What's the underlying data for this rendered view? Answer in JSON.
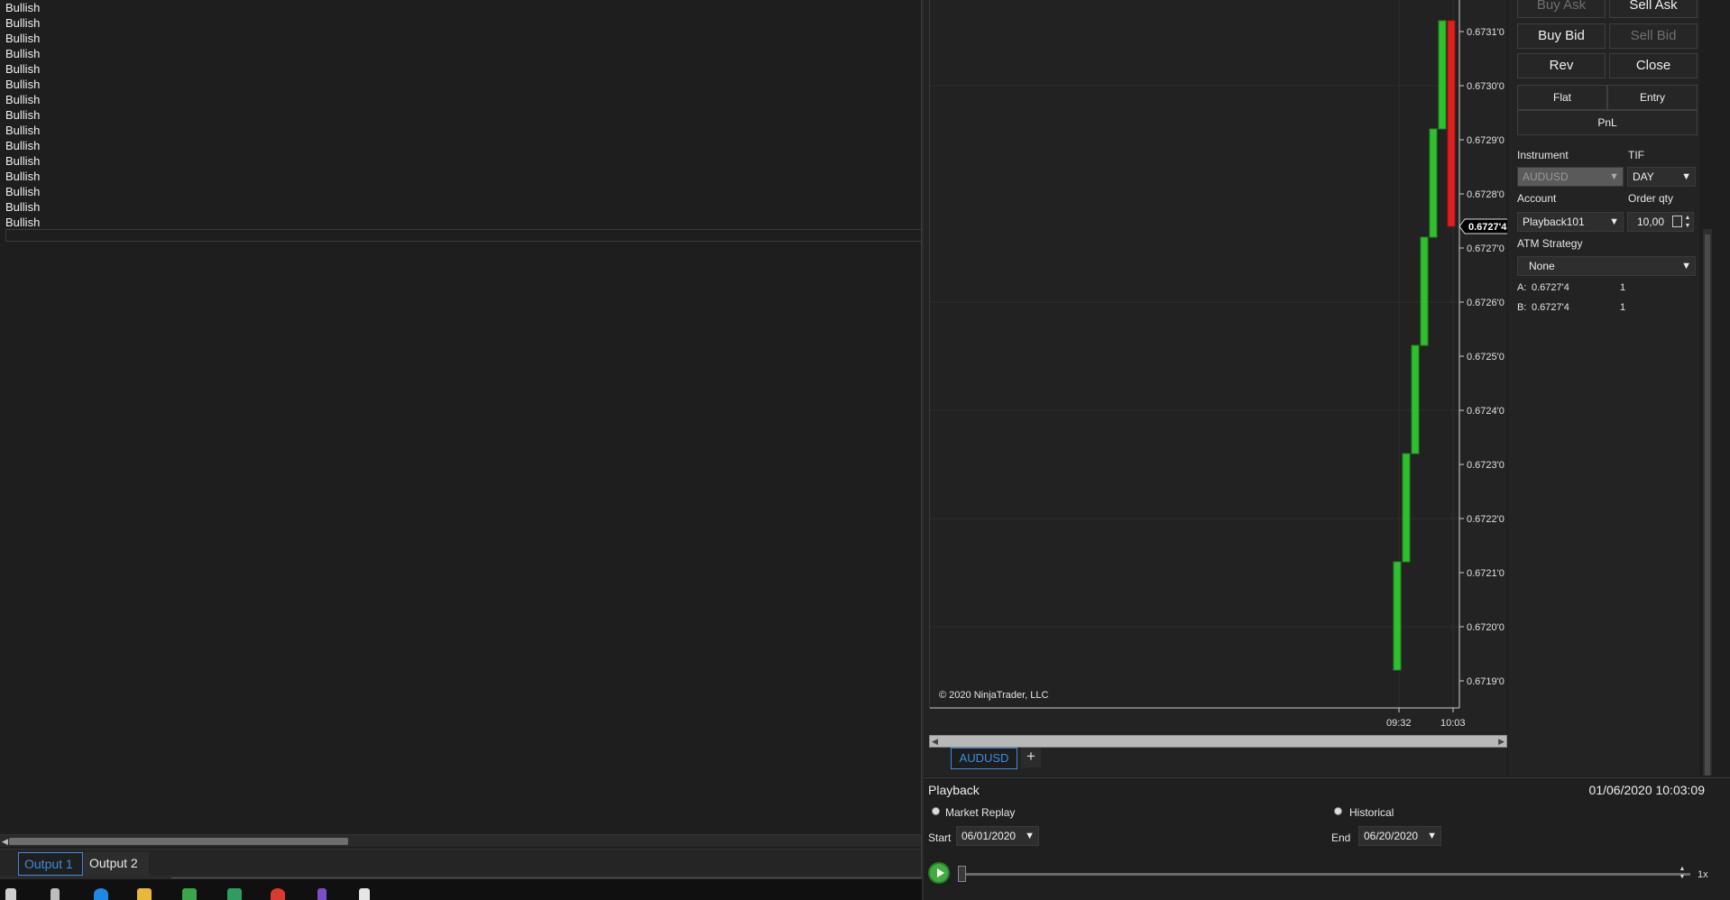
{
  "output": {
    "lines": [
      "Bullish",
      "Bullish",
      "Bullish",
      "Bullish",
      "Bullish",
      "Bullish",
      "Bullish",
      "Bullish",
      "Bullish",
      "Bullish",
      "Bullish",
      "Bullish",
      "Bullish",
      "Bullish",
      "Bullish"
    ],
    "tabs": [
      {
        "label": "Output 1",
        "active": true
      },
      {
        "label": "Output 2",
        "active": false
      }
    ]
  },
  "chart": {
    "instrument_tab": "AUDUSD",
    "add_tab": "+",
    "copyright": "© 2020 NinjaTrader, LLC",
    "current_price_label": "0.6727'4",
    "price_axis_labels": [
      "0.6731'0",
      "0.6730'0",
      "0.6729'0",
      "0.6728'0",
      "0.6727'0",
      "0.6726'0",
      "0.6725'0",
      "0.6724'0",
      "0.6723'0",
      "0.6722'0",
      "0.6721'0",
      "0.6720'0",
      "0.6719'0"
    ],
    "time_axis_labels": [
      "09:32",
      "10:03"
    ],
    "colors": {
      "up": "#2fbf2f",
      "down": "#e02020",
      "background": "#222222"
    }
  },
  "chart_data": {
    "type": "bar",
    "title": "",
    "xlabel": "",
    "ylabel": "",
    "ylim": [
      0.67185,
      0.67318
    ],
    "y_ticks": [
      0.6719,
      0.672,
      0.6721,
      0.6722,
      0.6723,
      0.6724,
      0.6725,
      0.6726,
      0.6727,
      0.6728,
      0.6729,
      0.673,
      0.6731
    ],
    "x_tick_labels": [
      "09:32",
      "10:03"
    ],
    "bars": [
      {
        "open": 0.67192,
        "close": 0.67212,
        "direction": "up"
      },
      {
        "open": 0.67212,
        "close": 0.67232,
        "direction": "up"
      },
      {
        "open": 0.67232,
        "close": 0.67252,
        "direction": "up"
      },
      {
        "open": 0.67252,
        "close": 0.67272,
        "direction": "up"
      },
      {
        "open": 0.67272,
        "close": 0.67292,
        "direction": "up"
      },
      {
        "open": 0.67292,
        "close": 0.67312,
        "direction": "up"
      },
      {
        "open": 0.67312,
        "close": 0.67274,
        "direction": "down"
      }
    ],
    "last_price": 0.67274
  },
  "trader": {
    "buy_ask": "Buy Ask",
    "sell_ask": "Sell Ask",
    "buy_bid": "Buy Bid",
    "sell_bid": "Sell Bid",
    "rev": "Rev",
    "close": "Close",
    "flat": "Flat",
    "entry": "Entry",
    "pnl": "PnL",
    "instrument_label": "Instrument",
    "instrument_value": "AUDUSD",
    "tif_label": "TIF",
    "tif_value": "DAY",
    "account_label": "Account",
    "account_value": "Playback101",
    "order_qty_label": "Order qty",
    "order_qty_value": "10,00",
    "atm_label": "ATM Strategy",
    "atm_value": "None",
    "ask_label": "A:",
    "ask_price": "0.6727'4",
    "ask_size": "1",
    "bid_label": "B:",
    "bid_price": "0.6727'4",
    "bid_size": "1"
  },
  "playback": {
    "title": "Playback",
    "datetime": "01/06/2020 10:03:09",
    "market_replay": "Market Replay",
    "historical": "Historical",
    "start_label": "Start",
    "start_date": "06/01/2020",
    "end_label": "End",
    "end_date": "06/20/2020",
    "speed": "1x"
  }
}
